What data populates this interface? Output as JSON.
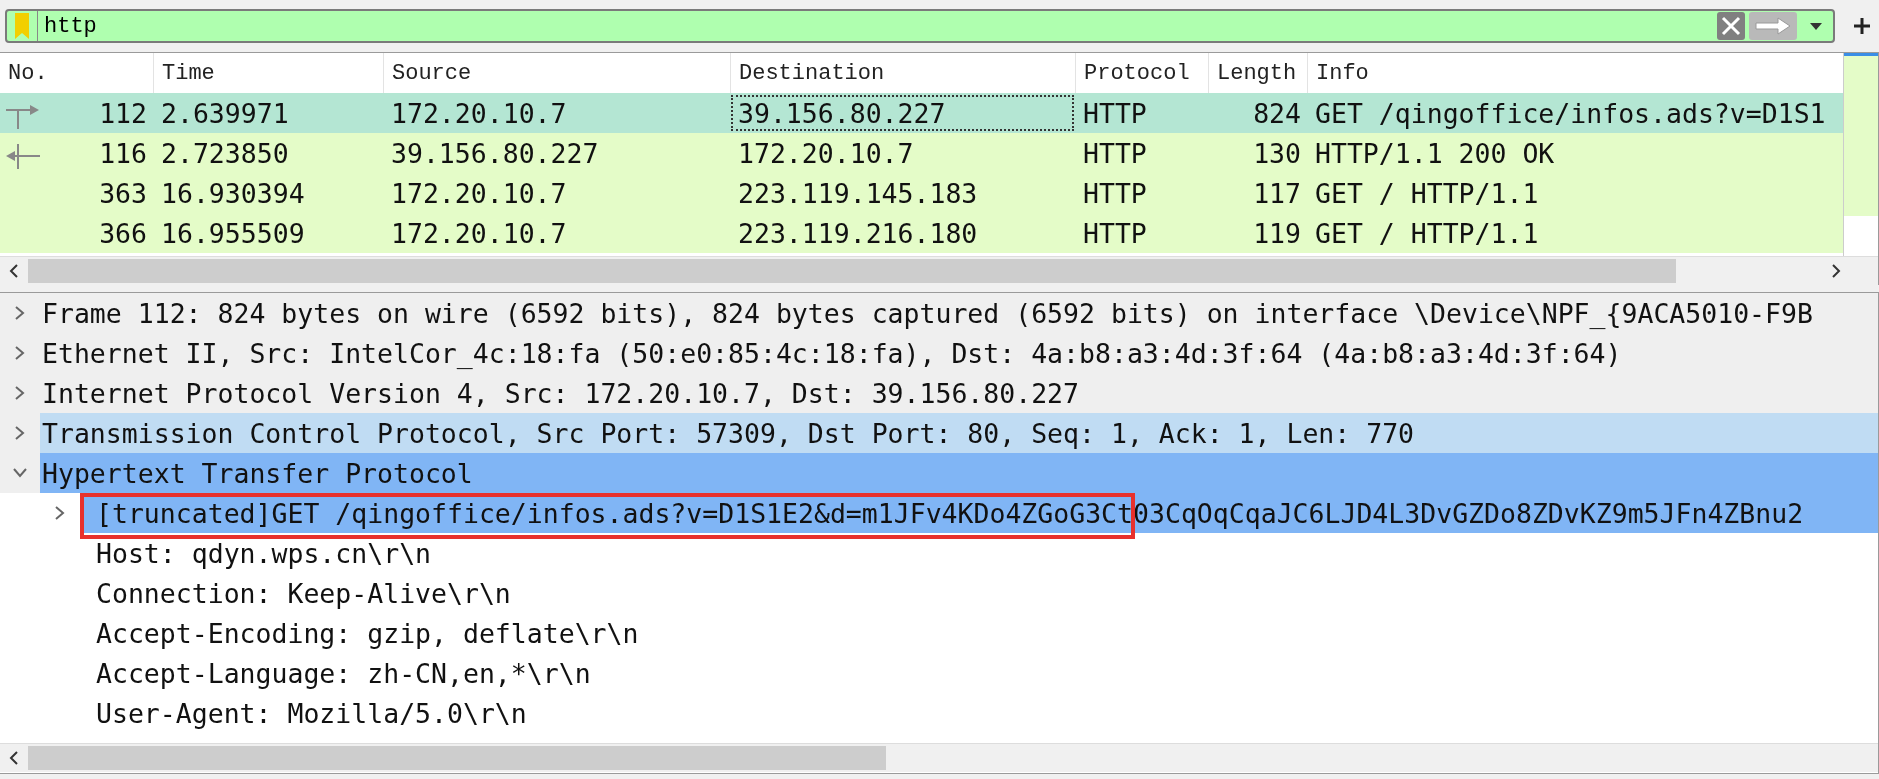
{
  "filter": {
    "value": "http",
    "valid": true
  },
  "packet_list": {
    "columns": [
      "No.",
      "Time",
      "Source",
      "Destination",
      "Protocol",
      "Length",
      "Info"
    ],
    "rows": [
      {
        "kind": "request",
        "selected": true,
        "cells": [
          {
            "text": "112",
            "focused": false
          },
          {
            "text": "2.639971",
            "focused": false
          },
          {
            "text": "172.20.10.7",
            "focused": false
          },
          {
            "text": "39.156.80.227",
            "focused": true
          },
          {
            "text": "HTTP",
            "focused": false
          },
          {
            "text": "824",
            "focused": false
          },
          {
            "text": "GET /qingoffice/infos.ads?v=D1S1",
            "focused": false
          }
        ]
      },
      {
        "kind": "response",
        "selected": false,
        "cells": [
          {
            "text": "116",
            "focused": false
          },
          {
            "text": "2.723850",
            "focused": false
          },
          {
            "text": "39.156.80.227",
            "focused": false
          },
          {
            "text": "172.20.10.7",
            "focused": false
          },
          {
            "text": "HTTP",
            "focused": false
          },
          {
            "text": "130",
            "focused": false
          },
          {
            "text": "HTTP/1.1 200 OK",
            "focused": false
          }
        ]
      },
      {
        "kind": "plain",
        "selected": false,
        "cells": [
          {
            "text": "363",
            "focused": false
          },
          {
            "text": "16.930394",
            "focused": false
          },
          {
            "text": "172.20.10.7",
            "focused": false
          },
          {
            "text": "223.119.145.183",
            "focused": false
          },
          {
            "text": "HTTP",
            "focused": false
          },
          {
            "text": "117",
            "focused": false
          },
          {
            "text": "GET / HTTP/1.1",
            "focused": false
          }
        ]
      },
      {
        "kind": "plain",
        "selected": false,
        "cells": [
          {
            "text": "366",
            "focused": false
          },
          {
            "text": "16.955509",
            "focused": false
          },
          {
            "text": "172.20.10.7",
            "focused": false
          },
          {
            "text": "223.119.216.180",
            "focused": false
          },
          {
            "text": "HTTP",
            "focused": false
          },
          {
            "text": "119",
            "focused": false
          },
          {
            "text": "GET / HTTP/1.1",
            "focused": false
          }
        ]
      }
    ]
  },
  "details": {
    "items": [
      {
        "kind": "branch",
        "label_parts": [
          {
            "text": "Frame 112: 824 bytes on wire (6592 bits), 824 bytes captured (6592 bits) on interface \\Device\\NPF_{9ACA5010-F9B",
            "boxed": false
          }
        ],
        "expanded": false,
        "selected": false,
        "hovered": false
      },
      {
        "kind": "branch",
        "label_parts": [
          {
            "text": "Ethernet II, Src: IntelCor_4c:18:fa (50:e0:85:4c:18:fa), Dst: 4a:b8:a3:4d:3f:64 (4a:b8:a3:4d:3f:64)",
            "boxed": false
          }
        ],
        "expanded": false,
        "selected": false,
        "hovered": false
      },
      {
        "kind": "branch",
        "label_parts": [
          {
            "text": "Internet Protocol Version 4, Src: 172.20.10.7, Dst: 39.156.80.227",
            "boxed": false
          }
        ],
        "expanded": false,
        "selected": false,
        "hovered": false
      },
      {
        "kind": "branch",
        "label_parts": [
          {
            "text": "Transmission Control Protocol, Src Port: 57309, Dst Port: 80, Seq: 1, Ack: 1, Len: 770",
            "boxed": false
          }
        ],
        "expanded": false,
        "selected": false,
        "hovered": true
      },
      {
        "kind": "branch",
        "label_parts": [
          {
            "text": "Hypertext Transfer Protocol",
            "boxed": false
          }
        ],
        "expanded": true,
        "selected": true,
        "hovered": false,
        "children": [
          {
            "kind": "branch",
            "label_parts": [
              {
                "text": "[truncated]GET /qingoffice/infos.ads?v=D1S1E2&d=m1JFv4KDo4ZGoG3Ct",
                "boxed": true
              },
              {
                "text": "03CqOqCqaJC6LJD4L3DvGZDo8ZDvKZ9m5JFn4ZBnu2",
                "boxed": false
              }
            ],
            "expanded": false,
            "selected": true,
            "hovered": false
          },
          {
            "kind": "leaf",
            "label_parts": [
              {
                "text": "Host: qdyn.wps.cn\\r\\n",
                "boxed": false
              }
            ],
            "selected": false,
            "hovered": false
          },
          {
            "kind": "leaf",
            "label_parts": [
              {
                "text": "Connection: Keep-Alive\\r\\n",
                "boxed": false
              }
            ],
            "selected": false,
            "hovered": false
          },
          {
            "kind": "leaf",
            "label_parts": [
              {
                "text": "Accept-Encoding: gzip, deflate\\r\\n",
                "boxed": false
              }
            ],
            "selected": false,
            "hovered": false
          },
          {
            "kind": "leaf",
            "label_parts": [
              {
                "text": "Accept-Language: zh-CN,en,*\\r\\n",
                "boxed": false
              }
            ],
            "selected": false,
            "hovered": false
          },
          {
            "kind": "leaf",
            "label_parts": [
              {
                "text": "User-Agent: Mozilla/5.0\\r\\n",
                "boxed": false
              }
            ],
            "selected": false,
            "hovered": false
          }
        ]
      }
    ]
  }
}
